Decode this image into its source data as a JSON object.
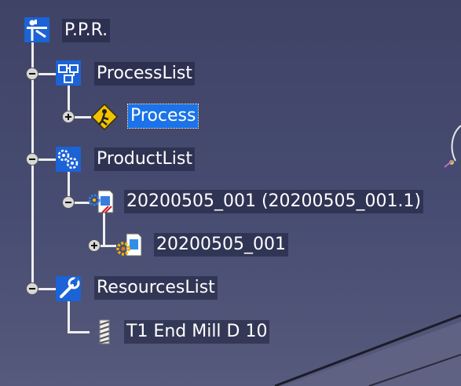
{
  "tree": {
    "root": {
      "label": "P.P.R.",
      "icon": "ppr-root-icon"
    },
    "process_list": {
      "label": "ProcessList",
      "icon": "process-list-icon",
      "expander": "expanded"
    },
    "process": {
      "label": "Process",
      "icon": "process-icon",
      "expander": "collapsed",
      "selected": true
    },
    "product_list": {
      "label": "ProductList",
      "icon": "product-list-icon",
      "expander": "expanded"
    },
    "product": {
      "label": "20200505_001 (20200505_001.1)",
      "icon": "product-icon",
      "expander": "expanded"
    },
    "part": {
      "label": "20200505_001",
      "icon": "part-icon",
      "expander": "collapsed"
    },
    "resources_list": {
      "label": "ResourcesList",
      "icon": "resources-list-icon",
      "expander": "expanded"
    },
    "tool": {
      "label": "T1 End Mill D 10",
      "icon": "end-mill-tool-icon"
    }
  },
  "colors": {
    "viewport_background": "#42476d",
    "selection": "#1a73e8",
    "tree_lines": "#eeeeee",
    "label_text": "#ffffff"
  }
}
